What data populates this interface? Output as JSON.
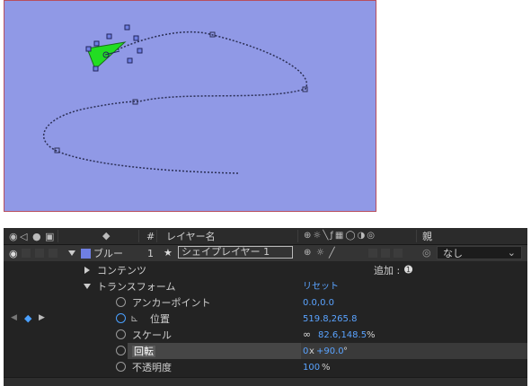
{
  "header": {
    "col_hash": "#",
    "col_layer_name": "レイヤー名",
    "col_parent": "親"
  },
  "layer": {
    "label_name": "ブルー",
    "index": "1",
    "name": "シェイプレイヤー 1",
    "parent_value": "なし",
    "label_color": "#6f7fe3"
  },
  "contents": {
    "label": "コンテンツ",
    "add_label": "追加 :"
  },
  "transform": {
    "label": "トランスフォーム",
    "reset_label": "リセット",
    "anchor": {
      "label": "アンカーポイント",
      "value": "0.0,0.0"
    },
    "position": {
      "label": "位置",
      "value": "519.8,265.8"
    },
    "scale": {
      "label": "スケール",
      "value": "82.6,148.5",
      "unit": "%"
    },
    "rotation": {
      "label": "回転",
      "turns": "0",
      "x": "x",
      "value": "+90.0",
      "unit": "°"
    },
    "opacity": {
      "label": "不透明度",
      "value": "100",
      "unit": "%"
    }
  },
  "colors": {
    "composition_bg": "#9099e6",
    "shape_fill": "#22dd22",
    "value_blue": "#5aa3ff",
    "keyframe_blue": "#4aa0ff"
  }
}
